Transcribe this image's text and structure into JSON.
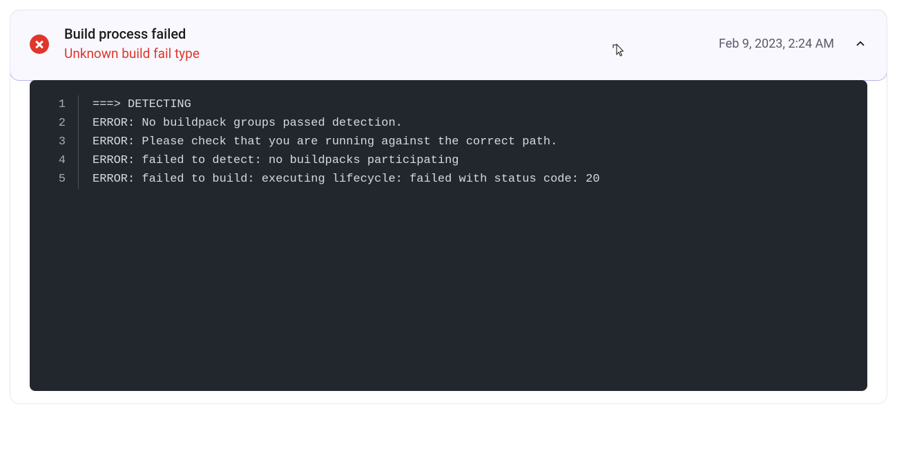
{
  "header": {
    "title": "Build process failed",
    "subtitle": "Unknown build fail type",
    "timestamp": "Feb 9, 2023, 2:24 AM"
  },
  "log": {
    "lines": [
      {
        "n": "1",
        "text": "===> DETECTING"
      },
      {
        "n": "2",
        "text": "ERROR: No buildpack groups passed detection."
      },
      {
        "n": "3",
        "text": "ERROR: Please check that you are running against the correct path."
      },
      {
        "n": "4",
        "text": "ERROR: failed to detect: no buildpacks participating"
      },
      {
        "n": "5",
        "text": "ERROR: failed to build: executing lifecycle: failed with status code: 20"
      }
    ]
  }
}
